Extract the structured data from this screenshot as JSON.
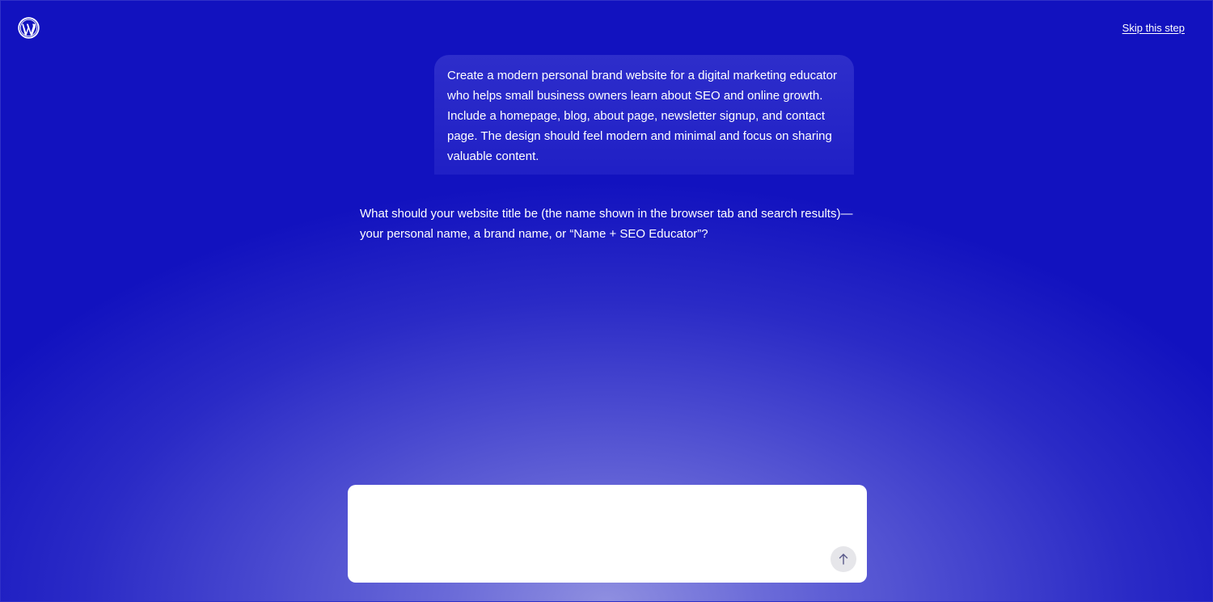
{
  "header": {
    "logo_icon": "wordpress-logo-icon",
    "skip_label": "Skip this step"
  },
  "conversation": {
    "user_prompt": "Create a modern personal brand website for a digital marketing educator who helps small business owners learn about SEO and online growth. Include a homepage, blog, about page, newsletter signup, and contact page. The design should feel modern and minimal and focus on sharing valuable content.",
    "assistant_question": "What should your website title be (the name shown in the browser tab and search results)—your personal name, a brand name, or “Name + SEO Educator”?"
  },
  "composer": {
    "value": "",
    "placeholder": "",
    "send_icon": "arrow-up-icon"
  },
  "colors": {
    "background_top": "#0a0abf",
    "background_glow": "#8f8fe0",
    "composer_bg": "#ffffff",
    "send_button_bg": "#e6e6ea",
    "send_icon": "#5a5a8a"
  }
}
